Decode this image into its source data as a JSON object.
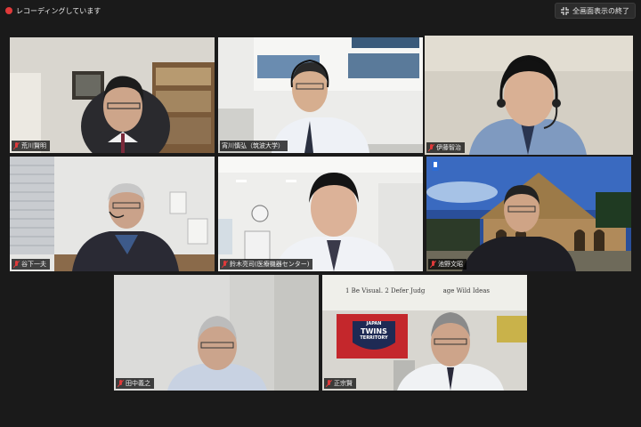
{
  "top_bar": {
    "recording_label": "レコーディングしています",
    "exit_fullscreen_label": "全画面表示の終了",
    "recording_color": "#e03a3a"
  },
  "active_speaker_color": "#cfe540",
  "participants": [
    {
      "name": "荒川賢明",
      "muted": true
    },
    {
      "name": "宵川慎弘（筑波大学）",
      "muted": false
    },
    {
      "name": "伊藤智治",
      "muted": true
    },
    {
      "name": "谷下一夫",
      "muted": true
    },
    {
      "name": "鈴木亮司(医療機器センター)",
      "muted": true
    },
    {
      "name": "池野文昭",
      "muted": true
    },
    {
      "name": "田中義之",
      "muted": true
    },
    {
      "name": "正宗賢",
      "muted": true
    }
  ],
  "banners": {
    "slogan": "1 Be Visual.  2 Defer Judg",
    "slogan_tail": "age Wild Ideas",
    "flag_line1": "JAPAN",
    "flag_line2": "TWINS",
    "flag_line3": "TERRITORY"
  },
  "icons": [
    "recording-dot-icon",
    "exit-fullscreen-icon",
    "mic-muted-icon",
    "hand-raise-icon"
  ]
}
